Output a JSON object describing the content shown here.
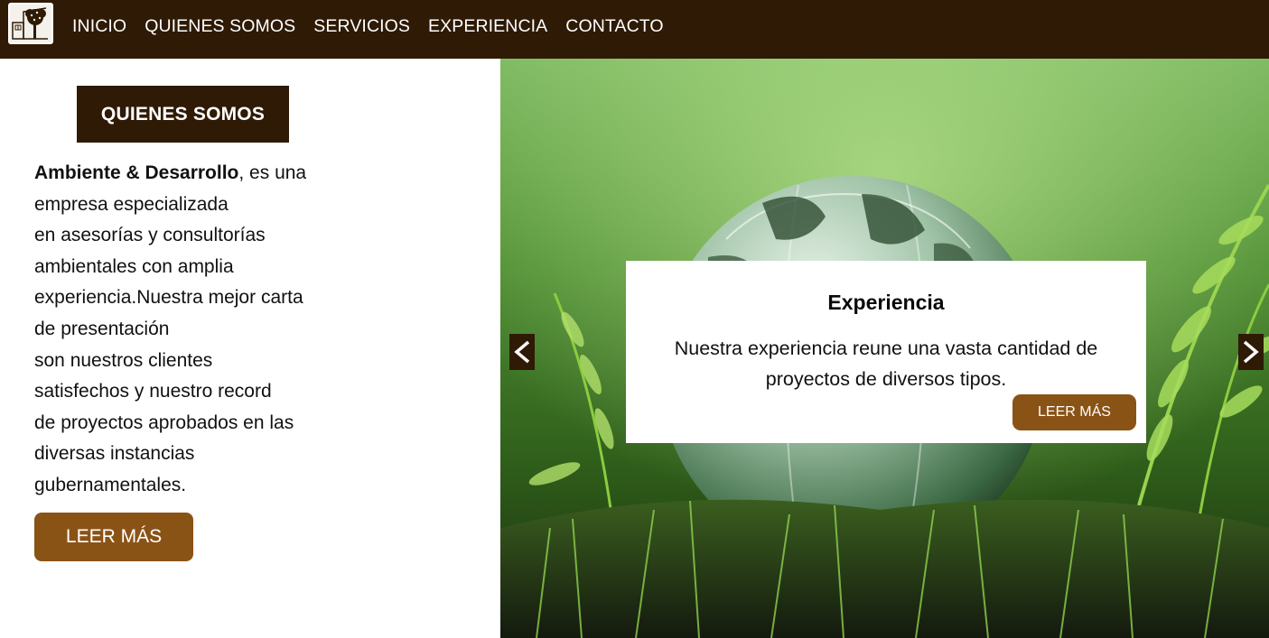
{
  "nav": {
    "items": [
      "INICIO",
      "QUIENES SOMOS",
      "SERVICIOS",
      "EXPERIENCIA",
      "CONTACTO"
    ]
  },
  "about": {
    "title": "QUIENES SOMOS",
    "brand": "Ambiente & Desarrollo",
    "lines": [
      ", es una",
      "empresa especializada",
      "en asesorías y consultorías",
      "ambientales con amplia",
      "experiencia.Nuestra mejor carta",
      "de presentación",
      "son nuestros clientes",
      "satisfechos y nuestro record",
      "de proyectos aprobados en las",
      "diversas instancias",
      "gubernamentales."
    ],
    "button_label": "LEER MÁS"
  },
  "slide": {
    "title": "Experiencia",
    "text_line1": "Nuestra experiencia reune una vasta cantidad de",
    "text_line2": "proyectos de diversos tipos.",
    "button_label": "LEER MÁS"
  },
  "icons": {
    "logo": "tree-logo-icon",
    "prev": "chevron-left-icon",
    "next": "chevron-right-icon"
  },
  "colors": {
    "header_bg": "#2e1a05",
    "button_bg": "#8a5316",
    "text": "#111111"
  }
}
